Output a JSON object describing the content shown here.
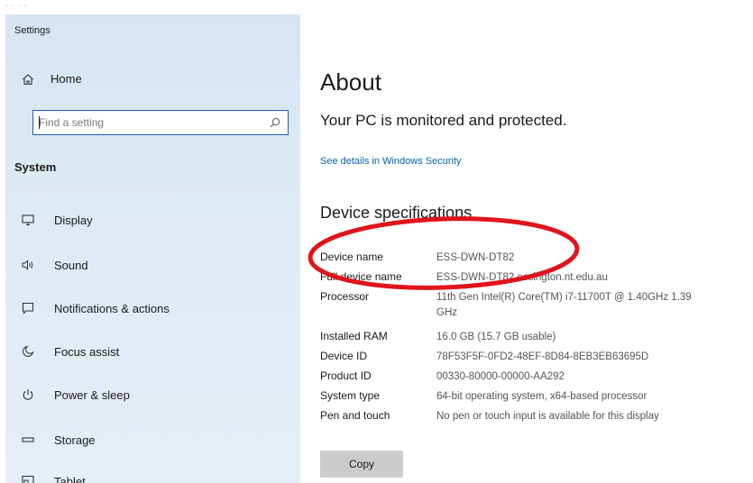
{
  "window": {
    "app_title": "Settings"
  },
  "sidebar": {
    "home_label": "Home",
    "search_placeholder": "Find a setting",
    "section_label": "System",
    "items": [
      {
        "label": "Display",
        "icon": "display-icon"
      },
      {
        "label": "Sound",
        "icon": "sound-icon"
      },
      {
        "label": "Notifications & actions",
        "icon": "notifications-icon"
      },
      {
        "label": "Focus assist",
        "icon": "focus-assist-icon"
      },
      {
        "label": "Power & sleep",
        "icon": "power-icon"
      },
      {
        "label": "Storage",
        "icon": "storage-icon"
      },
      {
        "label": "Tablet",
        "icon": "tablet-icon"
      }
    ]
  },
  "main": {
    "title": "About",
    "protection_status": "Your PC is monitored and protected.",
    "security_link": "See details in Windows Security",
    "spec_heading": "Device specifications",
    "specs": [
      {
        "label": "Device name",
        "value": "ESS-DWN-DT82"
      },
      {
        "label": "Full device name",
        "value": "ESS-DWN-DT82.essington.nt.edu.au"
      },
      {
        "label": "Processor",
        "value": "11th Gen Intel(R) Core(TM) i7-11700T @ 1.40GHz 1.39 GHz"
      },
      {
        "label": "Installed RAM",
        "value": "16.0 GB (15.7 GB usable)"
      },
      {
        "label": "Device ID",
        "value": "78F53F5F-0FD2-48EF-8D84-8EB3EB63695D"
      },
      {
        "label": "Product ID",
        "value": "00330-80000-00000-AA292"
      },
      {
        "label": "System type",
        "value": "64-bit operating system, x64-based processor"
      },
      {
        "label": "Pen and touch",
        "value": "No pen or touch input is available for this display"
      }
    ],
    "copy_label": "Copy"
  },
  "colors": {
    "accent": "#0a5fb0",
    "search_border": "#1e5eb8",
    "annotation": "#e0141b",
    "sidebar_bg": "#dbe7f4",
    "button_bg": "#cccccc"
  }
}
